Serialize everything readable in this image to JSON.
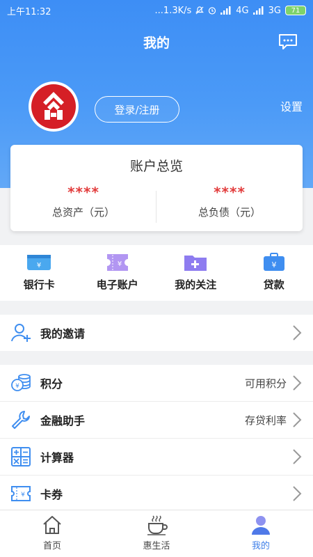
{
  "status_bar": {
    "time": "上午11:32",
    "network_speed": "...1.3K/s",
    "net1": "4G",
    "net2": "3G",
    "battery": "71"
  },
  "header": {
    "title": "我的",
    "login_label": "登录/注册",
    "settings_label": "设置"
  },
  "overview": {
    "title": "账户总览",
    "assets": {
      "value": "****",
      "label": "总资产（元）"
    },
    "liabilities": {
      "value": "****",
      "label": "总负债（元）"
    }
  },
  "quick_actions": [
    {
      "label": "银行卡",
      "icon": "bank-card-icon"
    },
    {
      "label": "电子账户",
      "icon": "e-account-icon"
    },
    {
      "label": "我的关注",
      "icon": "favorites-folder-icon"
    },
    {
      "label": "贷款",
      "icon": "loan-briefcase-icon"
    }
  ],
  "invite": {
    "label": "我的邀请",
    "icon": "add-person-icon"
  },
  "menu": [
    {
      "label": "积分",
      "hint": "可用积分",
      "icon": "points-coins-icon"
    },
    {
      "label": "金融助手",
      "hint": "存贷利率",
      "icon": "wrench-icon"
    },
    {
      "label": "计算器",
      "hint": "",
      "icon": "calculator-icon"
    },
    {
      "label": "卡券",
      "hint": "",
      "icon": "coupon-icon"
    }
  ],
  "bottom_nav": [
    {
      "label": "首页",
      "icon": "home-icon",
      "active": false
    },
    {
      "label": "惠生活",
      "icon": "coffee-cup-icon",
      "active": false
    },
    {
      "label": "我的",
      "icon": "user-icon",
      "active": true
    }
  ],
  "colors": {
    "primary": "#3d8ef5",
    "accent_red": "#e23b3b",
    "icon_blue": "#3f8ef0",
    "icon_purple": "#a98ef0"
  }
}
